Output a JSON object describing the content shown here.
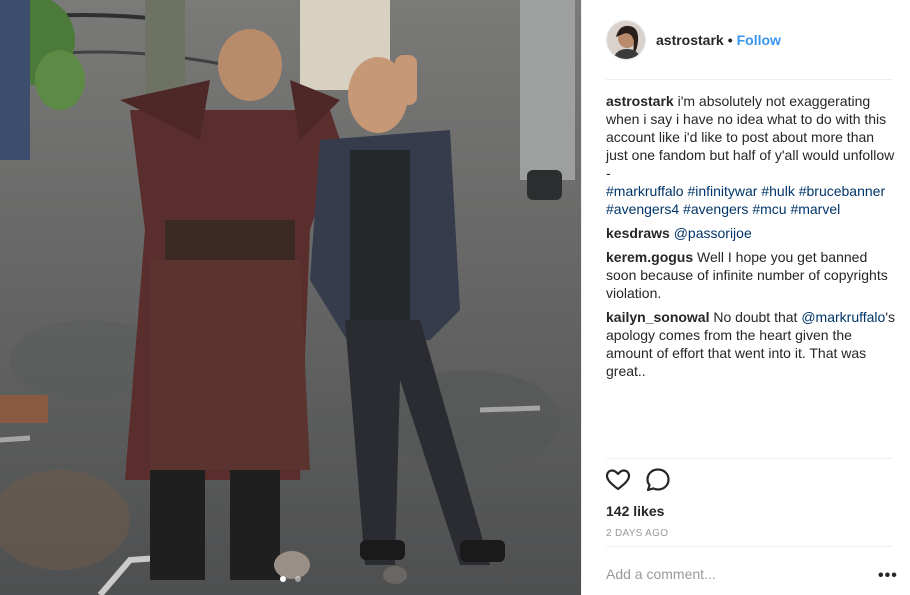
{
  "post": {
    "image_alt": "Two men standing on a film set street",
    "carousel_dots": [
      true,
      false
    ]
  },
  "header": {
    "username": "astrostark",
    "separator": "•",
    "follow_label": "Follow"
  },
  "caption": {
    "username": "astrostark",
    "text": "i'm absolutely not exaggerating when i say i have no idea what to do with this account like i'd like to post about more than just one fandom but half of y'all would unfollow",
    "dash": "-",
    "hashtags": "#markruffalo #infinitywar #hulk #brucebanner #avengers4 #avengers #mcu #marvel"
  },
  "comments": [
    {
      "username": "kesdraws",
      "mention": "@passorijoe",
      "text": ""
    },
    {
      "username": "kerem.gogus",
      "mention": "",
      "text": "Well I hope you get banned soon because of infinite number of copyrights violation."
    },
    {
      "username": "kailyn_sonowal",
      "text_before": "No doubt that",
      "mention": "@markruffalo",
      "text": "'s apology comes from the heart given the amount of effort that went into it. That was great.."
    }
  ],
  "actions": {
    "like_icon": "heart-icon",
    "comment_icon": "speech-bubble-icon"
  },
  "likes": "142 likes",
  "timestamp": "2 DAYS AGO",
  "add_comment": {
    "placeholder": "Add a comment..."
  },
  "more_label": "•••"
}
